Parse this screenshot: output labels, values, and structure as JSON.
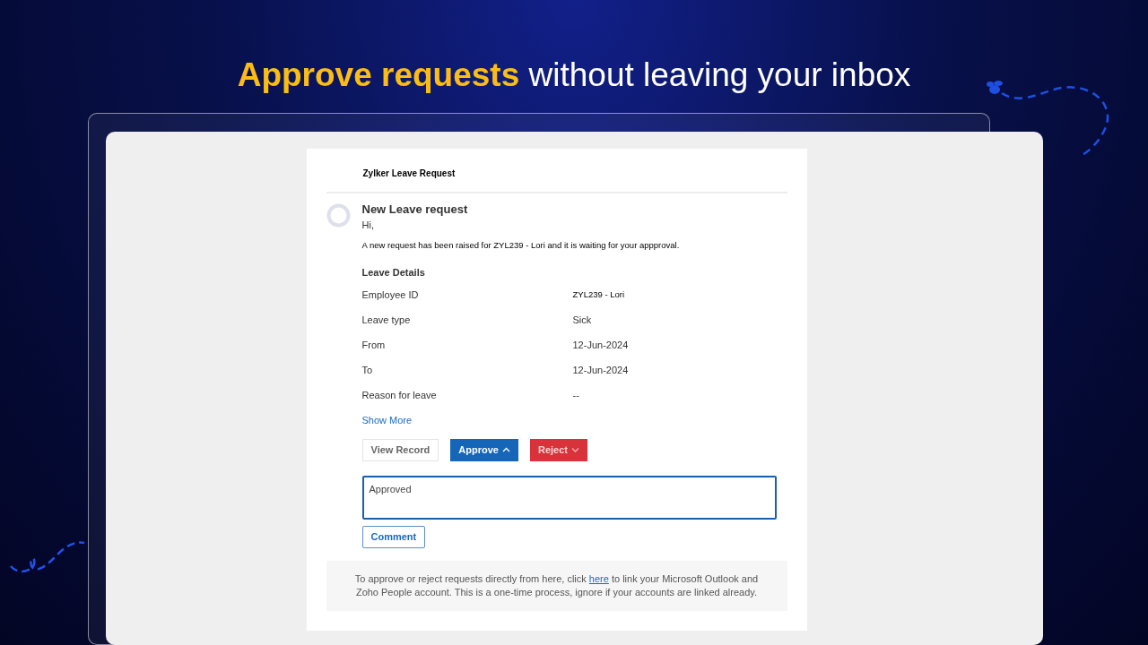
{
  "headline": {
    "highlight": "Approve requests",
    "rest": "without leaving your inbox"
  },
  "email": {
    "sender": "Zylker Leave Request",
    "subject": "New Leave request",
    "greeting": "Hi,",
    "message": "A new request has been raised for ZYL239 - Lori and it is waiting for your appproval.",
    "section_title": "Leave Details",
    "details": [
      {
        "label": "Employee ID",
        "value": "ZYL239 - Lori"
      },
      {
        "label": "Leave type",
        "value": "Sick"
      },
      {
        "label": "From",
        "value": "12-Jun-2024"
      },
      {
        "label": "To",
        "value": "12-Jun-2024"
      },
      {
        "label": "Reason for leave",
        "value": "--"
      }
    ],
    "show_more": "Show More",
    "actions": [
      {
        "kind": "outline",
        "label": "View Record",
        "disabled": false
      },
      {
        "kind": "primary",
        "label": "Approve",
        "disabled": false,
        "expanded": true
      },
      {
        "kind": "danger",
        "label": "Reject",
        "disabled": true,
        "expanded": false
      }
    ],
    "comment_value": "Approved",
    "comment_button": "Comment",
    "footer": {
      "before": "To approve or reject requests directly from here, click",
      "link": "here",
      "after": "to link your Microsoft Outlook and Zoho People account. This is a one-time process, ignore if your accounts are linked already."
    }
  }
}
